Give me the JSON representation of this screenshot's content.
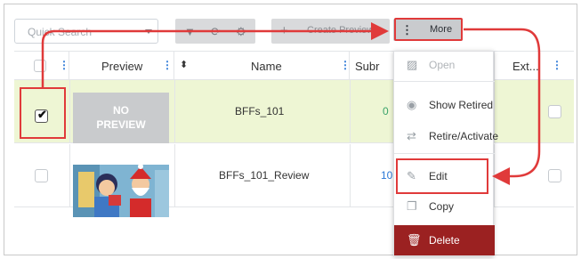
{
  "toolbar": {
    "search_placeholder": "Quick Search",
    "create_label": "Create Preview",
    "more_label": "More"
  },
  "table": {
    "columns": [
      {
        "label": ""
      },
      {
        "label": "Preview"
      },
      {
        "label": "Name"
      },
      {
        "label": "Subr"
      },
      {
        "label": "Ext..."
      }
    ],
    "rows": [
      {
        "checked": true,
        "preview": "NO PREVIEW",
        "name": "BFFs_101",
        "sub": "0"
      },
      {
        "checked": false,
        "preview": "image",
        "name": "BFFs_101_Review",
        "sub": "10"
      }
    ]
  },
  "menu": {
    "items": [
      {
        "label": "Open",
        "icon": "image-icon",
        "disabled": true
      },
      {
        "label": "Show Retired",
        "icon": "eye-icon"
      },
      {
        "label": "Retire/Activate",
        "icon": "swap-arrows-icon"
      },
      {
        "label": "Edit",
        "icon": "edit-icon"
      },
      {
        "label": "Copy",
        "icon": "copy-icon"
      },
      {
        "label": "Delete",
        "icon": "trash-icon"
      }
    ]
  },
  "colors": {
    "selected_row": "#eef6d4",
    "highlight": "#e03a3a",
    "delete_bg": "#9b2121",
    "link": "#2b78d6"
  }
}
